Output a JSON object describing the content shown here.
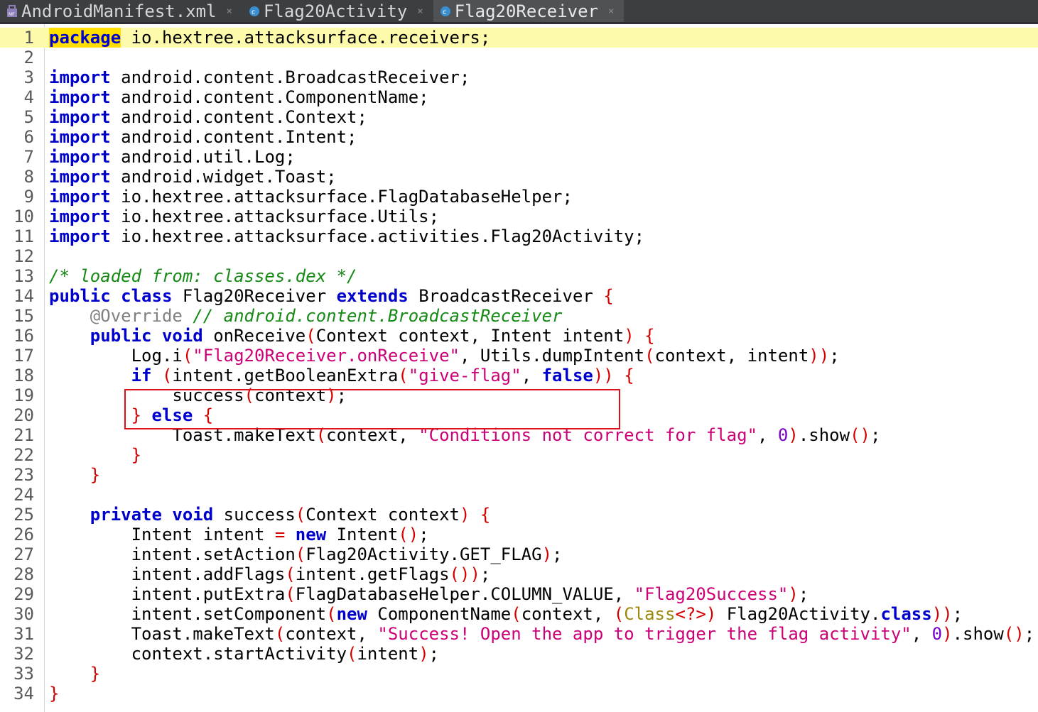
{
  "tabs": [
    {
      "label": "AndroidManifest.xml",
      "icon": "manifest-file-icon",
      "active": false
    },
    {
      "label": "Flag20Activity",
      "icon": "java-class-icon",
      "active": false
    },
    {
      "label": "Flag20Receiver",
      "icon": "java-class-icon",
      "active": true
    }
  ],
  "close_glyph": "×",
  "colors": {
    "keyword": "#0000cc",
    "string": "#cc0077",
    "comment": "#158a15",
    "bracket": "#d40000",
    "current_line": "#fdfbab",
    "highlight_box": "#e0101d"
  },
  "lines": [
    {
      "n": "1",
      "current": true,
      "tokens": [
        {
          "t": "package",
          "c": "kwhl"
        },
        {
          "t": " io.hextree.attacksurface.receivers;"
        }
      ]
    },
    {
      "n": "2",
      "tokens": []
    },
    {
      "n": "3",
      "tokens": [
        {
          "t": "import",
          "c": "kw"
        },
        {
          "t": " android.content.BroadcastReceiver;"
        }
      ]
    },
    {
      "n": "4",
      "tokens": [
        {
          "t": "import",
          "c": "kw"
        },
        {
          "t": " android.content.ComponentName;"
        }
      ]
    },
    {
      "n": "5",
      "tokens": [
        {
          "t": "import",
          "c": "kw"
        },
        {
          "t": " android.content.Context;"
        }
      ]
    },
    {
      "n": "6",
      "tokens": [
        {
          "t": "import",
          "c": "kw"
        },
        {
          "t": " android.content.Intent;"
        }
      ]
    },
    {
      "n": "7",
      "tokens": [
        {
          "t": "import",
          "c": "kw"
        },
        {
          "t": " android.util.Log;"
        }
      ]
    },
    {
      "n": "8",
      "tokens": [
        {
          "t": "import",
          "c": "kw"
        },
        {
          "t": " android.widget.Toast;"
        }
      ]
    },
    {
      "n": "9",
      "tokens": [
        {
          "t": "import",
          "c": "kw"
        },
        {
          "t": " io.hextree.attacksurface.FlagDatabaseHelper;"
        }
      ]
    },
    {
      "n": "10",
      "tokens": [
        {
          "t": "import",
          "c": "kw"
        },
        {
          "t": " io.hextree.attacksurface.Utils;"
        }
      ]
    },
    {
      "n": "11",
      "tokens": [
        {
          "t": "import",
          "c": "kw"
        },
        {
          "t": " io.hextree.attacksurface.activities.Flag20Activity;"
        }
      ]
    },
    {
      "n": "12",
      "tokens": []
    },
    {
      "n": "13",
      "tokens": [
        {
          "t": "/* loaded from: classes.dex */",
          "c": "cmt"
        }
      ]
    },
    {
      "n": "14",
      "tokens": [
        {
          "t": "public",
          "c": "kw"
        },
        {
          "t": " "
        },
        {
          "t": "class",
          "c": "kw"
        },
        {
          "t": " Flag20Receiver "
        },
        {
          "t": "extends",
          "c": "kw"
        },
        {
          "t": " BroadcastReceiver "
        },
        {
          "t": "{",
          "c": "br"
        }
      ]
    },
    {
      "n": "15",
      "tokens": [
        {
          "t": "    "
        },
        {
          "t": "@Override",
          "c": "anno"
        },
        {
          "t": " "
        },
        {
          "t": "// android.content.BroadcastReceiver",
          "c": "cmt"
        }
      ]
    },
    {
      "n": "16",
      "tokens": [
        {
          "t": "    "
        },
        {
          "t": "public",
          "c": "kw"
        },
        {
          "t": " "
        },
        {
          "t": "void",
          "c": "kw"
        },
        {
          "t": " onReceive"
        },
        {
          "t": "(",
          "c": "br"
        },
        {
          "t": "Context context, Intent intent"
        },
        {
          "t": ")",
          "c": "br"
        },
        {
          "t": " "
        },
        {
          "t": "{",
          "c": "br"
        }
      ]
    },
    {
      "n": "17",
      "tokens": [
        {
          "t": "        Log.i"
        },
        {
          "t": "(",
          "c": "br"
        },
        {
          "t": "\"Flag20Receiver.onReceive\"",
          "c": "str"
        },
        {
          "t": ", Utils.dumpIntent"
        },
        {
          "t": "(",
          "c": "br"
        },
        {
          "t": "context, intent"
        },
        {
          "t": "))",
          "c": "br"
        },
        {
          "t": ";"
        }
      ]
    },
    {
      "n": "18",
      "tokens": [
        {
          "t": "        "
        },
        {
          "t": "if",
          "c": "kw"
        },
        {
          "t": " "
        },
        {
          "t": "(",
          "c": "br"
        },
        {
          "t": "intent.getBooleanExtra"
        },
        {
          "t": "(",
          "c": "br"
        },
        {
          "t": "\"give-flag\"",
          "c": "str"
        },
        {
          "t": ", "
        },
        {
          "t": "false",
          "c": "kw"
        },
        {
          "t": "))",
          "c": "br"
        },
        {
          "t": " "
        },
        {
          "t": "{",
          "c": "br"
        }
      ]
    },
    {
      "n": "19",
      "tokens": [
        {
          "t": "            success"
        },
        {
          "t": "(",
          "c": "br"
        },
        {
          "t": "context"
        },
        {
          "t": ")",
          "c": "br"
        },
        {
          "t": ";"
        }
      ]
    },
    {
      "n": "20",
      "tokens": [
        {
          "t": "        "
        },
        {
          "t": "}",
          "c": "br"
        },
        {
          "t": " "
        },
        {
          "t": "else",
          "c": "kw"
        },
        {
          "t": " "
        },
        {
          "t": "{",
          "c": "br"
        }
      ]
    },
    {
      "n": "21",
      "tokens": [
        {
          "t": "            Toast.makeText"
        },
        {
          "t": "(",
          "c": "br"
        },
        {
          "t": "context, "
        },
        {
          "t": "\"Conditions not correct for flag\"",
          "c": "str"
        },
        {
          "t": ", "
        },
        {
          "t": "0",
          "c": "num"
        },
        {
          "t": ")",
          "c": "br"
        },
        {
          "t": ".show"
        },
        {
          "t": "()",
          "c": "br"
        },
        {
          "t": ";"
        }
      ]
    },
    {
      "n": "22",
      "tokens": [
        {
          "t": "        "
        },
        {
          "t": "}",
          "c": "br"
        }
      ]
    },
    {
      "n": "23",
      "tokens": [
        {
          "t": "    "
        },
        {
          "t": "}",
          "c": "br"
        }
      ]
    },
    {
      "n": "24",
      "tokens": []
    },
    {
      "n": "25",
      "tokens": [
        {
          "t": "    "
        },
        {
          "t": "private",
          "c": "kw"
        },
        {
          "t": " "
        },
        {
          "t": "void",
          "c": "kw"
        },
        {
          "t": " success"
        },
        {
          "t": "(",
          "c": "br"
        },
        {
          "t": "Context context"
        },
        {
          "t": ")",
          "c": "br"
        },
        {
          "t": " "
        },
        {
          "t": "{",
          "c": "br"
        }
      ]
    },
    {
      "n": "26",
      "tokens": [
        {
          "t": "        Intent intent "
        },
        {
          "t": "=",
          "c": "br"
        },
        {
          "t": " "
        },
        {
          "t": "new",
          "c": "kw"
        },
        {
          "t": " Intent"
        },
        {
          "t": "()",
          "c": "br"
        },
        {
          "t": ";"
        }
      ]
    },
    {
      "n": "27",
      "tokens": [
        {
          "t": "        intent.setAction"
        },
        {
          "t": "(",
          "c": "br"
        },
        {
          "t": "Flag20Activity.GET_FLAG"
        },
        {
          "t": ")",
          "c": "br"
        },
        {
          "t": ";"
        }
      ]
    },
    {
      "n": "28",
      "tokens": [
        {
          "t": "        intent.addFlags"
        },
        {
          "t": "(",
          "c": "br"
        },
        {
          "t": "intent.getFlags"
        },
        {
          "t": "())",
          "c": "br"
        },
        {
          "t": ";"
        }
      ]
    },
    {
      "n": "29",
      "tokens": [
        {
          "t": "        intent.putExtra"
        },
        {
          "t": "(",
          "c": "br"
        },
        {
          "t": "FlagDatabaseHelper.COLUMN_VALUE, "
        },
        {
          "t": "\"Flag20Success\"",
          "c": "str"
        },
        {
          "t": ")",
          "c": "br"
        },
        {
          "t": ";"
        }
      ]
    },
    {
      "n": "30",
      "tokens": [
        {
          "t": "        intent.setComponent"
        },
        {
          "t": "(",
          "c": "br"
        },
        {
          "t": "new",
          "c": "kw"
        },
        {
          "t": " ComponentName"
        },
        {
          "t": "(",
          "c": "br"
        },
        {
          "t": "context, "
        },
        {
          "t": "(",
          "c": "br"
        },
        {
          "t": "Class",
          "c": "cls"
        },
        {
          "t": "<?>",
          "c": "br"
        },
        {
          "t": ")",
          "c": "br"
        },
        {
          "t": " Flag20Activity."
        },
        {
          "t": "class",
          "c": "kw"
        },
        {
          "t": "))",
          "c": "br"
        },
        {
          "t": ";"
        }
      ]
    },
    {
      "n": "31",
      "tokens": [
        {
          "t": "        Toast.makeText"
        },
        {
          "t": "(",
          "c": "br"
        },
        {
          "t": "context, "
        },
        {
          "t": "\"Success! Open the app to trigger the flag activity\"",
          "c": "str"
        },
        {
          "t": ", "
        },
        {
          "t": "0",
          "c": "num"
        },
        {
          "t": ")",
          "c": "br"
        },
        {
          "t": ".show"
        },
        {
          "t": "()",
          "c": "br"
        },
        {
          "t": ";"
        }
      ]
    },
    {
      "n": "32",
      "tokens": [
        {
          "t": "        context.startActivity"
        },
        {
          "t": "(",
          "c": "br"
        },
        {
          "t": "intent"
        },
        {
          "t": ")",
          "c": "br"
        },
        {
          "t": ";"
        }
      ]
    },
    {
      "n": "33",
      "tokens": [
        {
          "t": "    "
        },
        {
          "t": "}",
          "c": "br"
        }
      ]
    },
    {
      "n": "34",
      "tokens": [
        {
          "t": "}",
          "c": "br"
        }
      ]
    }
  ]
}
